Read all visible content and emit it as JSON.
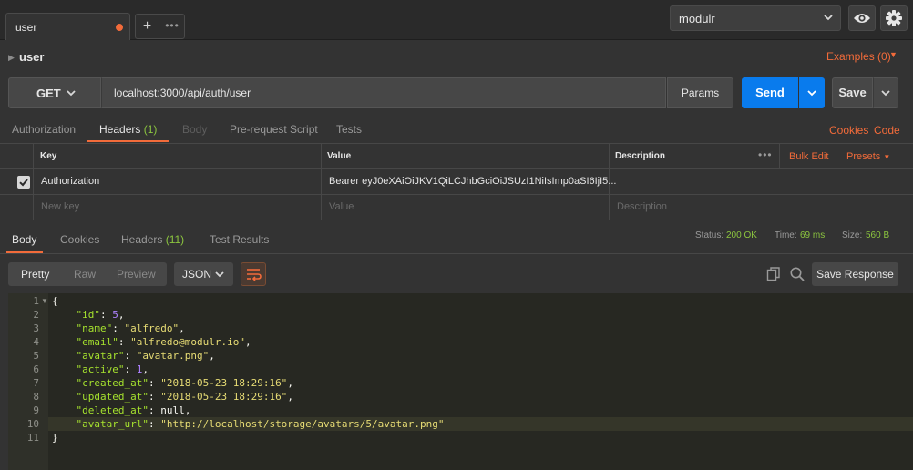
{
  "tabs": {
    "active_tab": "user",
    "unsaved_color": "#f26b3a",
    "new_tab": "+",
    "more": "•••"
  },
  "environment": {
    "selected": "modulr"
  },
  "request": {
    "name": "user",
    "examples": "Examples (0)",
    "method": "GET",
    "url": "localhost:3000/api/auth/user",
    "params_label": "Params",
    "send_label": "Send",
    "save_label": "Save"
  },
  "request_tabs": [
    {
      "label": "Authorization",
      "count": ""
    },
    {
      "label": "Headers",
      "count": "(1)"
    },
    {
      "label": "Body",
      "count": ""
    },
    {
      "label": "Pre-request Script",
      "count": ""
    },
    {
      "label": "Tests",
      "count": ""
    }
  ],
  "request_links": {
    "cookies": "Cookies",
    "code": "Code"
  },
  "headers_table": {
    "columns": [
      "Key",
      "Value",
      "Description"
    ],
    "more": "•••",
    "bulk_edit": "Bulk Edit",
    "presets": "Presets",
    "rows": [
      {
        "key": "Authorization",
        "value": "Bearer eyJ0eXAiOiJKV1QiLCJhbGciOiJSUzI1NiIsImp0aSI6IjI5...",
        "description": "",
        "checked": true
      }
    ],
    "placeholder": {
      "key": "New key",
      "value": "Value",
      "description": "Description"
    }
  },
  "response": {
    "tabs": [
      {
        "label": "Body",
        "count": ""
      },
      {
        "label": "Cookies",
        "count": ""
      },
      {
        "label": "Headers",
        "count": "(11)"
      },
      {
        "label": "Test Results",
        "count": ""
      }
    ],
    "status_label": "Status:",
    "status_value": "200 OK",
    "time_label": "Time:",
    "time_value": "69 ms",
    "size_label": "Size:",
    "size_value": "560 B",
    "view_modes": [
      "Pretty",
      "Raw",
      "Preview"
    ],
    "format": "JSON",
    "save_response": "Save Response"
  },
  "code": {
    "line_numbers": [
      "1",
      "2",
      "3",
      "4",
      "5",
      "6",
      "7",
      "8",
      "9",
      "10",
      "11"
    ],
    "open_brace": "{",
    "close_brace": "}",
    "fields": [
      {
        "key": "\"id\"",
        "value": "5",
        "type": "number",
        "comma": ","
      },
      {
        "key": "\"name\"",
        "value": "\"alfredo\"",
        "type": "string",
        "comma": ","
      },
      {
        "key": "\"email\"",
        "value": "\"alfredo@modulr.io\"",
        "type": "string",
        "comma": ","
      },
      {
        "key": "\"avatar\"",
        "value": "\"avatar.png\"",
        "type": "string",
        "comma": ","
      },
      {
        "key": "\"active\"",
        "value": "1",
        "type": "number",
        "comma": ","
      },
      {
        "key": "\"created_at\"",
        "value": "\"2018-05-23 18:29:16\"",
        "type": "string",
        "comma": ","
      },
      {
        "key": "\"updated_at\"",
        "value": "\"2018-05-23 18:29:16\"",
        "type": "string",
        "comma": ","
      },
      {
        "key": "\"deleted_at\"",
        "value": "null",
        "type": "null",
        "comma": ","
      },
      {
        "key": "\"avatar_url\"",
        "value": "\"http://localhost/storage/avatars/5/avatar.png\"",
        "type": "string",
        "comma": ""
      }
    ]
  },
  "colors": {
    "accent": "#f26b3a",
    "send": "#097bed",
    "success": "#8cc63f",
    "key": "#a6e22e",
    "string": "#e6db74",
    "number": "#ae81ff"
  }
}
